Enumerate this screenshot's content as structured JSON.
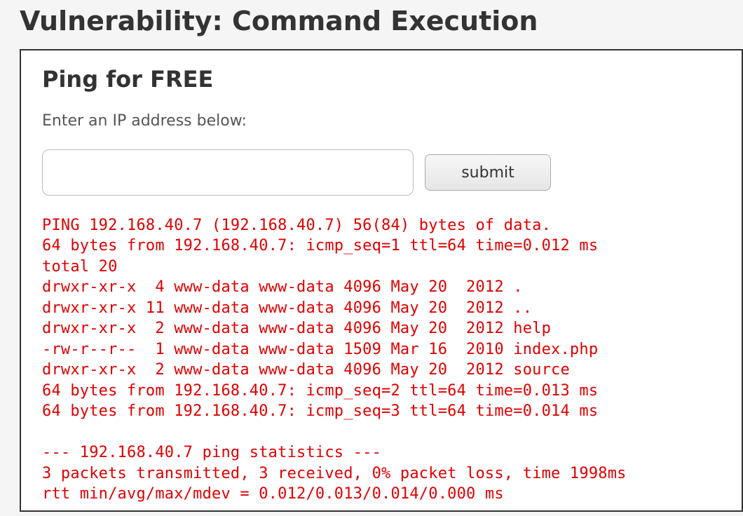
{
  "header": {
    "title": "Vulnerability: Command Execution"
  },
  "panel": {
    "heading": "Ping for FREE",
    "prompt": "Enter an IP address below:",
    "input_value": "",
    "submit_label": "submit"
  },
  "output_lines": [
    "PING 192.168.40.7 (192.168.40.7) 56(84) bytes of data.",
    "64 bytes from 192.168.40.7: icmp_seq=1 ttl=64 time=0.012 ms",
    "total 20",
    "drwxr-xr-x  4 www-data www-data 4096 May 20  2012 .",
    "drwxr-xr-x 11 www-data www-data 4096 May 20  2012 ..",
    "drwxr-xr-x  2 www-data www-data 4096 May 20  2012 help",
    "-rw-r--r--  1 www-data www-data 1509 Mar 16  2010 index.php",
    "drwxr-xr-x  2 www-data www-data 4096 May 20  2012 source",
    "64 bytes from 192.168.40.7: icmp_seq=2 ttl=64 time=0.013 ms",
    "64 bytes from 192.168.40.7: icmp_seq=3 ttl=64 time=0.014 ms",
    "",
    "--- 192.168.40.7 ping statistics ---",
    "3 packets transmitted, 3 received, 0% packet loss, time 1998ms",
    "rtt min/avg/max/mdev = 0.012/0.013/0.014/0.000 ms"
  ]
}
